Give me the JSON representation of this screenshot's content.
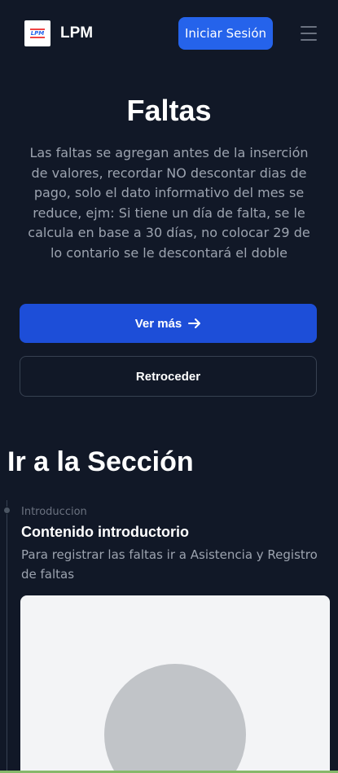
{
  "navbar": {
    "logo_text": "LPM",
    "brand_name": "LPM",
    "login_label": "Iniciar Sesión",
    "menu_icon": "hamburger-icon"
  },
  "hero": {
    "title": "Faltas",
    "description": "Las faltas se agregan antes de la inserción de valores, recordar NO descontar dias de pago, solo el dato informativo del mes se reduce, ejm: Si tiene un día de falta, se le calcula en base a 30 días, no colocar 29 de lo contario se le descontará el doble",
    "primary_label": "Ver más",
    "primary_icon": "arrow-right-icon",
    "secondary_label": "Retroceder"
  },
  "section": {
    "title": "Ir a la Sección"
  },
  "timeline": {
    "items": [
      {
        "meta": "Introduccion",
        "heading": "Contenido introductorio",
        "text": "Para registrar las faltas ir a Asistencia y Registro de faltas"
      }
    ]
  },
  "colors": {
    "background": "#111827",
    "accent": "#2563eb",
    "muted_text": "#9ca3af"
  }
}
